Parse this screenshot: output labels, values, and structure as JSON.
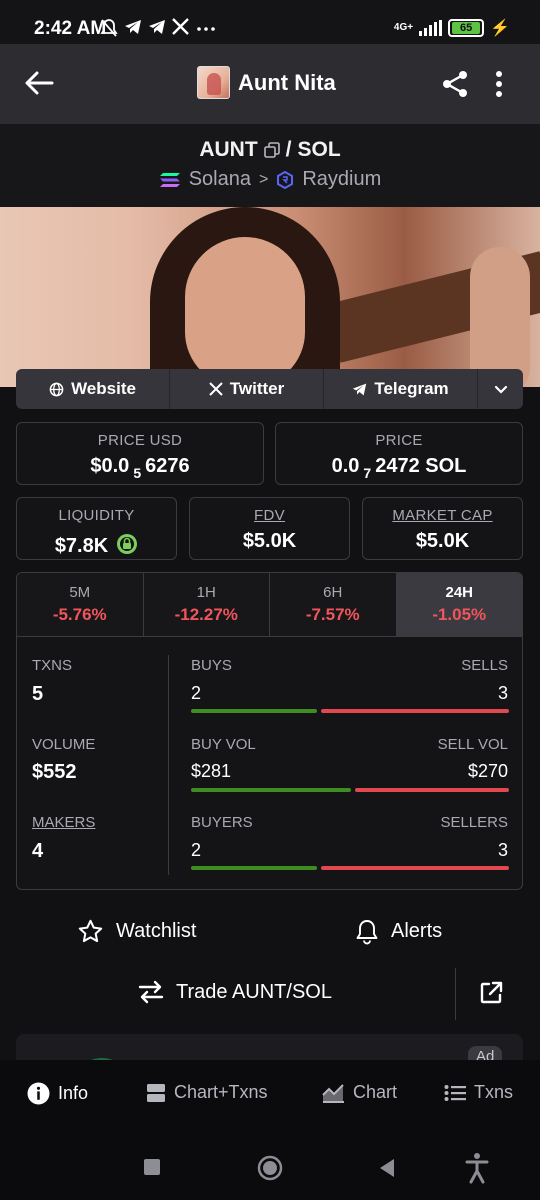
{
  "status_bar": {
    "time": "2:42 AM",
    "left_icons": [
      "mute-icon",
      "telegram-icon",
      "telegram-icon",
      "x-icon",
      "more-dots-icon"
    ],
    "network": "4G+",
    "battery": "65"
  },
  "header": {
    "title": "Aunt Nita"
  },
  "pair": {
    "base": "AUNT",
    "separator": "/",
    "quote": "SOL",
    "chain": "Solana",
    "arrow": ">",
    "dex": "Raydium"
  },
  "links": {
    "website": "Website",
    "twitter": "Twitter",
    "telegram": "Telegram"
  },
  "price_usd": {
    "label": "PRICE USD",
    "prefix": "$0.0",
    "zeros": "5",
    "digits": "6276"
  },
  "price": {
    "label": "PRICE",
    "prefix": "0.0",
    "zeros": "7",
    "digits": "2472 SOL"
  },
  "liquidity": {
    "label": "LIQUIDITY",
    "value": "$7.8K"
  },
  "fdv": {
    "label": "FDV",
    "value": "$5.0K"
  },
  "market_cap": {
    "label": "MARKET CAP",
    "value": "$5.0K"
  },
  "timeframes": [
    {
      "label": "5M",
      "change": "-5.76%"
    },
    {
      "label": "1H",
      "change": "-12.27%"
    },
    {
      "label": "6H",
      "change": "-7.57%"
    },
    {
      "label": "24H",
      "change": "-1.05%",
      "selected": true
    }
  ],
  "stats": {
    "txns": {
      "label": "TXNS",
      "value": "5"
    },
    "volume": {
      "label": "VOLUME",
      "value": "$552"
    },
    "makers": {
      "label": "MAKERS",
      "value": "4"
    },
    "buys": {
      "label": "BUYS",
      "value": "2",
      "fraction": 0.4
    },
    "sells": {
      "label": "SELLS",
      "value": "3"
    },
    "buy_vol": {
      "label": "BUY VOL",
      "value": "$281",
      "fraction": 0.51
    },
    "sell_vol": {
      "label": "SELL VOL",
      "value": "$270"
    },
    "buyers": {
      "label": "BUYERS",
      "value": "2",
      "fraction": 0.4
    },
    "sellers": {
      "label": "SELLERS",
      "value": "3"
    }
  },
  "actions": {
    "watchlist": "Watchlist",
    "alerts": "Alerts",
    "trade": "Trade AUNT/SOL"
  },
  "ad": {
    "badge": "Ad"
  },
  "bottom_nav": {
    "info": "Info",
    "chart_txns": "Chart+Txns",
    "chart": "Chart",
    "txns": "Txns"
  },
  "colors": {
    "positive": "#3e8d22",
    "negative": "#e3484e",
    "negative_text": "#f0555b",
    "background": "#111114"
  }
}
